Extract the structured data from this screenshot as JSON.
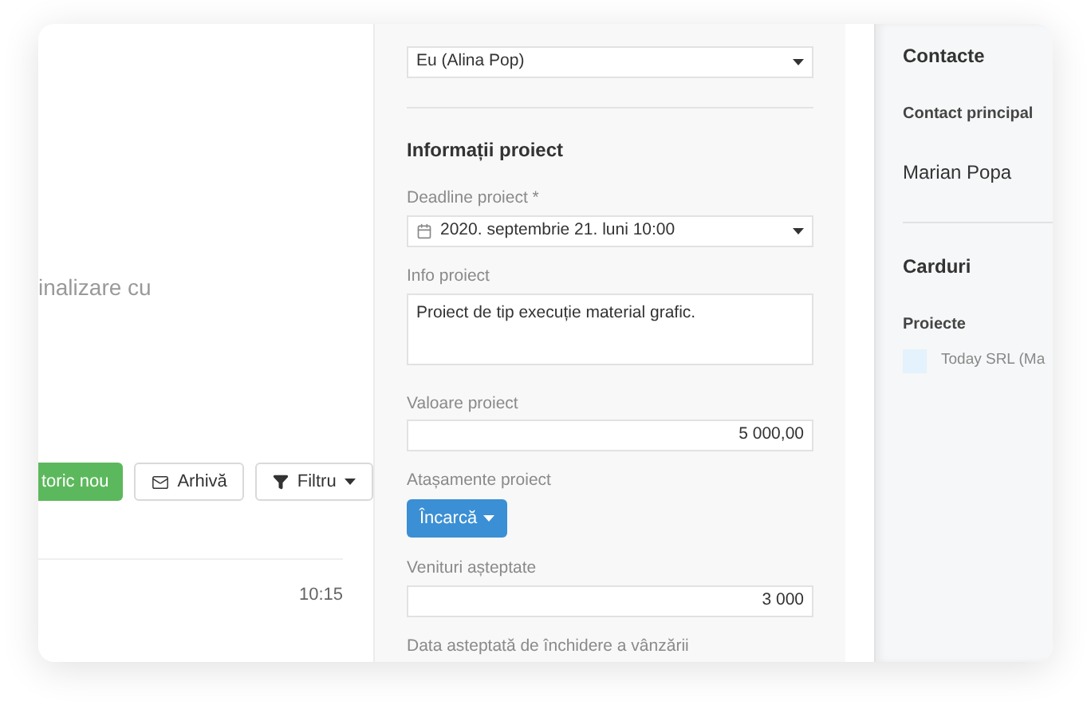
{
  "left_panel": {
    "description": "inalizare cu",
    "buttons": [
      {
        "kind": "primary",
        "label": "toric nou"
      },
      {
        "kind": "archive",
        "label": "Arhivă"
      },
      {
        "kind": "filter",
        "label": "Filtru"
      }
    ],
    "time": "10:15"
  },
  "form": {
    "owner_select": {
      "value": "Eu (Alina Pop)"
    },
    "section_title": "Informații proiect",
    "fields": [
      {
        "kind": "date",
        "label": "Deadline proiect *",
        "value": "2020. septembrie 21. luni 10:00"
      },
      {
        "kind": "textarea",
        "label": "Info proiect",
        "value": "Proiect de tip execuție material grafic."
      },
      {
        "kind": "number",
        "label": "Valoare proiect",
        "value": "5 000,00"
      },
      {
        "kind": "upload",
        "label": "Atașamente proiect",
        "value": "Încarcă"
      },
      {
        "kind": "number",
        "label": "Venituri așteptate",
        "value": "3 000"
      },
      {
        "kind": "label_only",
        "label": "Data asteptată de închidere a vânzării"
      }
    ]
  },
  "sidebar": {
    "contacts_title": "Contacte",
    "contact_label": "Contact principal",
    "contact_name": "Marian Popa",
    "cards_title": "Carduri",
    "projects_label": "Proiecte",
    "projects": [
      {
        "name": "Today SRL (Ma",
        "color": "#e3f2fc"
      }
    ]
  }
}
